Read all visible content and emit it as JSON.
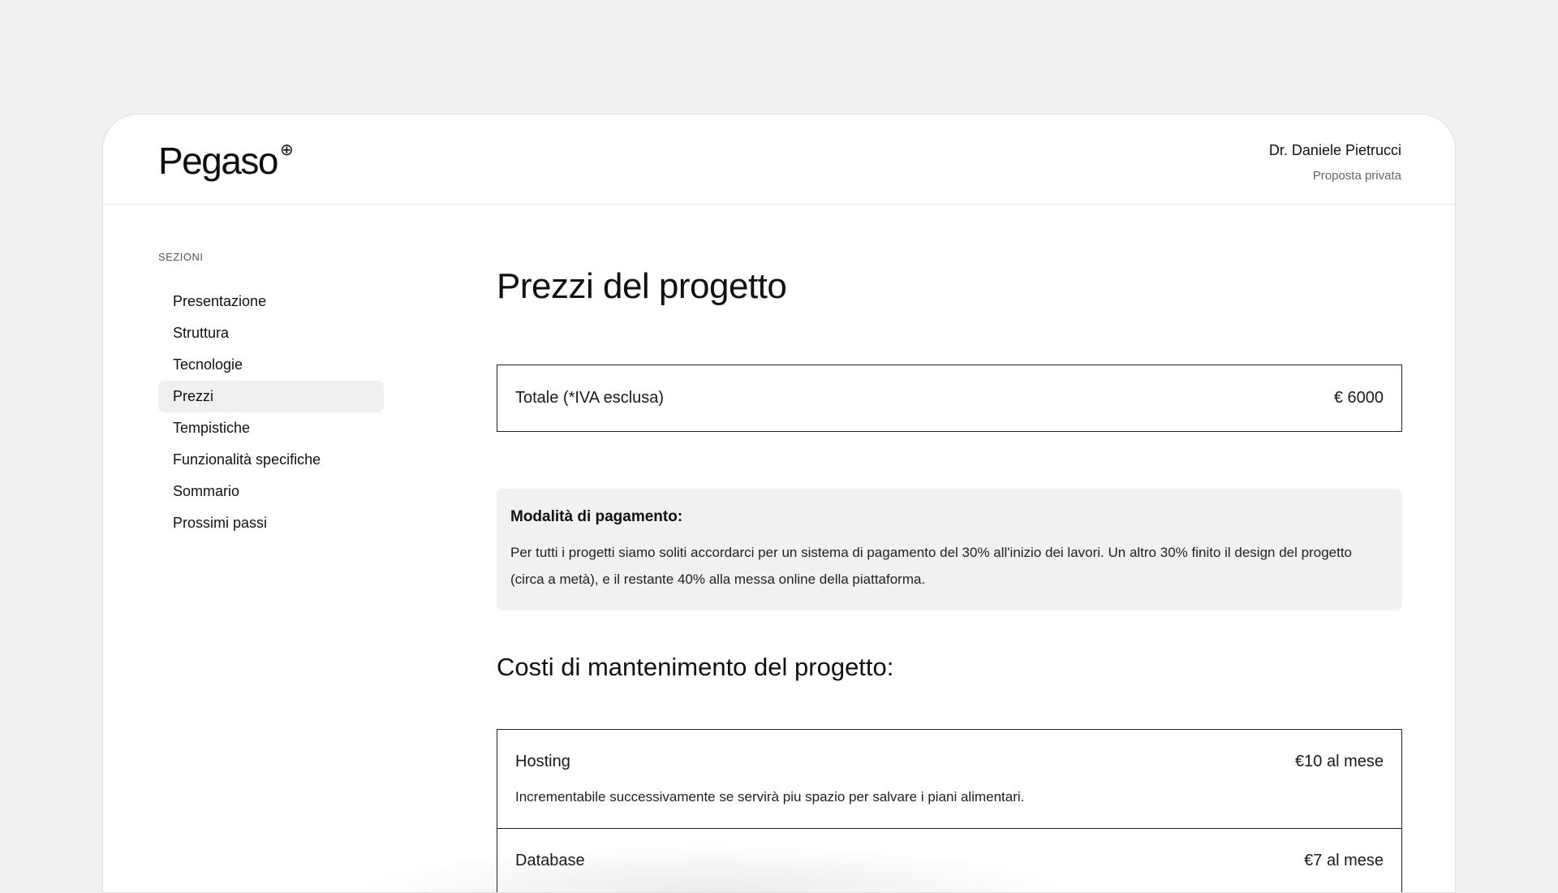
{
  "header": {
    "brand": "Pegaso",
    "brand_mark": "⊕",
    "user_name": "Dr. Daniele Pietrucci",
    "user_subtitle": "Proposta privata"
  },
  "sidebar": {
    "label": "SEZIONI",
    "items": [
      {
        "label": "Presentazione"
      },
      {
        "label": "Struttura"
      },
      {
        "label": "Tecnologie"
      },
      {
        "label": "Prezzi"
      },
      {
        "label": "Tempistiche"
      },
      {
        "label": "Funzionalità specifiche"
      },
      {
        "label": "Sommario"
      },
      {
        "label": "Prossimi passi"
      }
    ],
    "active": "Prezzi"
  },
  "main": {
    "title": "Prezzi del progetto",
    "total": {
      "label": "Totale (*IVA esclusa)",
      "value": "€ 6000"
    },
    "payment": {
      "title": "Modalità di pagamento:",
      "text": "Per tutti i progetti siamo soliti accordarci per un sistema di pagamento del 30% all'inizio dei lavori. Un altro 30% finito il design del progetto (circa a metà), e il restante 40% alla messa online della piattaforma."
    },
    "maintenance_title": "Costi di mantenimento del progetto:",
    "costs": [
      {
        "name": "Hosting",
        "price": "€10 al mese",
        "description": "Incrementabile successivamente se servirà piu spazio per salvare i piani alimentari."
      },
      {
        "name": "Database",
        "price": "€7 al mese",
        "description": ""
      }
    ]
  },
  "colors": {
    "background": "#f1f1f3",
    "card": "#ffffff",
    "active_nav": "#f0f0f2",
    "border": "#222222"
  }
}
